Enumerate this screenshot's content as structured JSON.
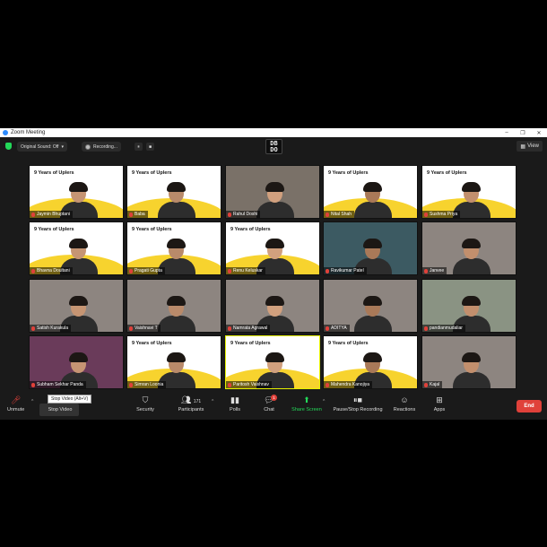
{
  "window": {
    "title": "Zoom Meeting",
    "minimize": "–",
    "maximize": "❐",
    "close": "✕"
  },
  "topbar": {
    "original_sound": "Original Sound: Off",
    "recording": "Recording...",
    "pause_glyph": "⏸",
    "stop_glyph": "■",
    "view_label": "View",
    "logo_text": "DB\nDO"
  },
  "participants": [
    {
      "name": "Jaymin Bhuptani",
      "bg": "brand",
      "brand": "9 Years of Uplers"
    },
    {
      "name": "Baba",
      "bg": "brand",
      "brand": "9 Years of Uplers"
    },
    {
      "name": "Rahul Doshi",
      "bg": "photo",
      "brand": ""
    },
    {
      "name": "Nital Shah",
      "bg": "brand",
      "brand": "9 Years of Uplers"
    },
    {
      "name": "Sushma Priya",
      "bg": "brand",
      "brand": "9 Years of Uplers"
    },
    {
      "name": "Bhavna Doultani",
      "bg": "brand",
      "brand": "9 Years of Uplers"
    },
    {
      "name": "Pragati Gupta",
      "bg": "brand",
      "brand": "9 Years of Uplers"
    },
    {
      "name": "Renu Keluskar",
      "bg": "brand",
      "brand": "9 Years of Uplers"
    },
    {
      "name": "Ravikumar Patel",
      "bg": "teal",
      "brand": ""
    },
    {
      "name": "Janvee",
      "bg": "room",
      "brand": ""
    },
    {
      "name": "Satish Kurakula",
      "bg": "room",
      "brand": ""
    },
    {
      "name": "Vaishnavi T",
      "bg": "room",
      "brand": ""
    },
    {
      "name": "Namrata Agrawal",
      "bg": "room",
      "brand": ""
    },
    {
      "name": "ADITYA",
      "bg": "room",
      "brand": ""
    },
    {
      "name": "pandianmudaliar",
      "bg": "plant",
      "brand": ""
    },
    {
      "name": "Subham Sekhar Panda",
      "bg": "purple",
      "brand": ""
    },
    {
      "name": "Simran Loonia",
      "bg": "brand",
      "brand": "9 Years of Uplers"
    },
    {
      "name": "Paritosh Vaishnav",
      "bg": "brand",
      "brand": "9 Years of Uplers"
    },
    {
      "name": "Mahendra Kanojiya",
      "bg": "brand",
      "brand": "9 Years of Uplers"
    },
    {
      "name": "Kajal",
      "bg": "room",
      "brand": ""
    }
  ],
  "toolbar": {
    "unmute": "Unmute",
    "stop_video": "Stop Video",
    "stop_video_tooltip": "Stop Video (Alt+V)",
    "security": "Security",
    "participants": "Participants",
    "participants_count": "171",
    "polls": "Polls",
    "chat": "Chat",
    "chat_badge": "1",
    "share_screen": "Share Screen",
    "pause_stop_recording": "Pause/Stop Recording",
    "reactions": "Reactions",
    "apps": "Apps",
    "end": "End"
  },
  "colors": {
    "accent_green": "#23d959",
    "end_red": "#e0413a",
    "brand_yellow": "#f7d32e",
    "active_speaker": "#e6f200"
  }
}
